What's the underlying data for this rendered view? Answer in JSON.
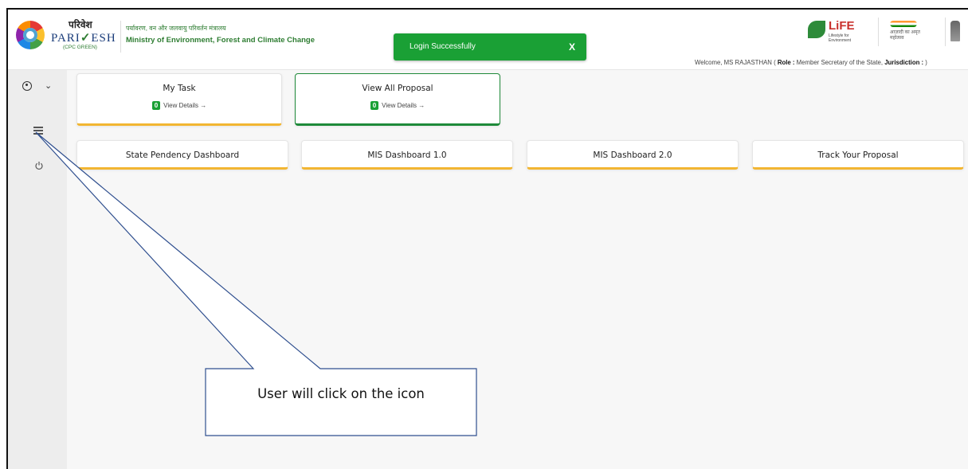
{
  "header": {
    "brand_hindi": "परिवेश",
    "brand_name_left": "PARI",
    "brand_name_right": "ESH",
    "brand_check": "✓",
    "brand_sub": "(CPC GREEN)",
    "ministry_hindi": "पर्यावरण, वन और जलवायु परिवर्तन मंत्रालय",
    "ministry_en": "Ministry of Environment, Forest and Climate Change",
    "life_text": "LiFE",
    "life_sub": "Lifestyle for Environment",
    "azadi_text": "आज़ादी का अमृत महोत्सव",
    "welcome_prefix": "Welcome, MS RAJASTHAN ( ",
    "role_label": "Role :",
    "role_value": " Member Secretary of the State, ",
    "jurisdiction_label": "Jurisdiction :",
    "welcome_suffix": " )"
  },
  "toast": {
    "message": "Login Successfully",
    "close_label": "X"
  },
  "sidebar": {
    "user_icon": "user-circle-icon",
    "chevron": "⌄",
    "menu_icon": "list-menu-icon",
    "power_icon": "power-icon"
  },
  "cards": [
    {
      "title": "My Task",
      "count": "0",
      "link": "View Details →"
    },
    {
      "title": "View All Proposal",
      "count": "0",
      "link": "View Details →"
    }
  ],
  "dashboards": [
    {
      "title": "State Pendency Dashboard"
    },
    {
      "title": "MIS Dashboard 1.0"
    },
    {
      "title": "MIS Dashboard 2.0"
    },
    {
      "title": "Track Your Proposal"
    }
  ],
  "annotation": {
    "text": "User will click on the icon"
  },
  "colors": {
    "accent_green": "#1aa035",
    "accent_yellow": "#f2b632",
    "sidebar_bg": "#ededed",
    "callout_stroke": "#2f4f8f"
  }
}
